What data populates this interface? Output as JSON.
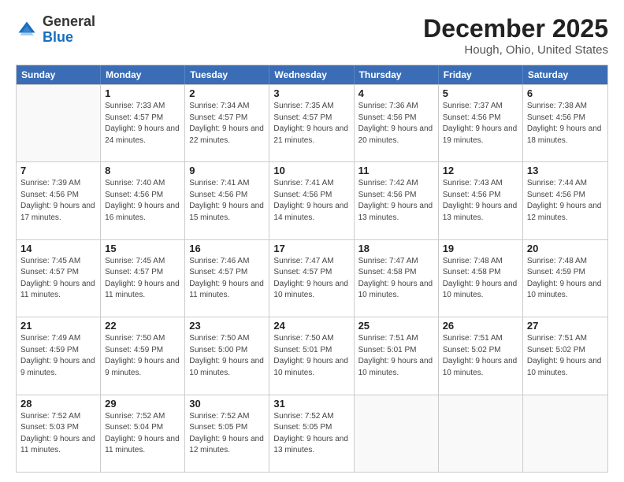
{
  "logo": {
    "text_general": "General",
    "text_blue": "Blue"
  },
  "title": "December 2025",
  "subtitle": "Hough, Ohio, United States",
  "header_days": [
    "Sunday",
    "Monday",
    "Tuesday",
    "Wednesday",
    "Thursday",
    "Friday",
    "Saturday"
  ],
  "rows": [
    [
      {
        "day": "",
        "empty": true
      },
      {
        "day": "1",
        "sunrise": "Sunrise: 7:33 AM",
        "sunset": "Sunset: 4:57 PM",
        "daylight": "Daylight: 9 hours and 24 minutes."
      },
      {
        "day": "2",
        "sunrise": "Sunrise: 7:34 AM",
        "sunset": "Sunset: 4:57 PM",
        "daylight": "Daylight: 9 hours and 22 minutes."
      },
      {
        "day": "3",
        "sunrise": "Sunrise: 7:35 AM",
        "sunset": "Sunset: 4:57 PM",
        "daylight": "Daylight: 9 hours and 21 minutes."
      },
      {
        "day": "4",
        "sunrise": "Sunrise: 7:36 AM",
        "sunset": "Sunset: 4:56 PM",
        "daylight": "Daylight: 9 hours and 20 minutes."
      },
      {
        "day": "5",
        "sunrise": "Sunrise: 7:37 AM",
        "sunset": "Sunset: 4:56 PM",
        "daylight": "Daylight: 9 hours and 19 minutes."
      },
      {
        "day": "6",
        "sunrise": "Sunrise: 7:38 AM",
        "sunset": "Sunset: 4:56 PM",
        "daylight": "Daylight: 9 hours and 18 minutes."
      }
    ],
    [
      {
        "day": "7",
        "sunrise": "Sunrise: 7:39 AM",
        "sunset": "Sunset: 4:56 PM",
        "daylight": "Daylight: 9 hours and 17 minutes."
      },
      {
        "day": "8",
        "sunrise": "Sunrise: 7:40 AM",
        "sunset": "Sunset: 4:56 PM",
        "daylight": "Daylight: 9 hours and 16 minutes."
      },
      {
        "day": "9",
        "sunrise": "Sunrise: 7:41 AM",
        "sunset": "Sunset: 4:56 PM",
        "daylight": "Daylight: 9 hours and 15 minutes."
      },
      {
        "day": "10",
        "sunrise": "Sunrise: 7:41 AM",
        "sunset": "Sunset: 4:56 PM",
        "daylight": "Daylight: 9 hours and 14 minutes."
      },
      {
        "day": "11",
        "sunrise": "Sunrise: 7:42 AM",
        "sunset": "Sunset: 4:56 PM",
        "daylight": "Daylight: 9 hours and 13 minutes."
      },
      {
        "day": "12",
        "sunrise": "Sunrise: 7:43 AM",
        "sunset": "Sunset: 4:56 PM",
        "daylight": "Daylight: 9 hours and 13 minutes."
      },
      {
        "day": "13",
        "sunrise": "Sunrise: 7:44 AM",
        "sunset": "Sunset: 4:56 PM",
        "daylight": "Daylight: 9 hours and 12 minutes."
      }
    ],
    [
      {
        "day": "14",
        "sunrise": "Sunrise: 7:45 AM",
        "sunset": "Sunset: 4:57 PM",
        "daylight": "Daylight: 9 hours and 11 minutes."
      },
      {
        "day": "15",
        "sunrise": "Sunrise: 7:45 AM",
        "sunset": "Sunset: 4:57 PM",
        "daylight": "Daylight: 9 hours and 11 minutes."
      },
      {
        "day": "16",
        "sunrise": "Sunrise: 7:46 AM",
        "sunset": "Sunset: 4:57 PM",
        "daylight": "Daylight: 9 hours and 11 minutes."
      },
      {
        "day": "17",
        "sunrise": "Sunrise: 7:47 AM",
        "sunset": "Sunset: 4:57 PM",
        "daylight": "Daylight: 9 hours and 10 minutes."
      },
      {
        "day": "18",
        "sunrise": "Sunrise: 7:47 AM",
        "sunset": "Sunset: 4:58 PM",
        "daylight": "Daylight: 9 hours and 10 minutes."
      },
      {
        "day": "19",
        "sunrise": "Sunrise: 7:48 AM",
        "sunset": "Sunset: 4:58 PM",
        "daylight": "Daylight: 9 hours and 10 minutes."
      },
      {
        "day": "20",
        "sunrise": "Sunrise: 7:48 AM",
        "sunset": "Sunset: 4:59 PM",
        "daylight": "Daylight: 9 hours and 10 minutes."
      }
    ],
    [
      {
        "day": "21",
        "sunrise": "Sunrise: 7:49 AM",
        "sunset": "Sunset: 4:59 PM",
        "daylight": "Daylight: 9 hours and 9 minutes."
      },
      {
        "day": "22",
        "sunrise": "Sunrise: 7:50 AM",
        "sunset": "Sunset: 4:59 PM",
        "daylight": "Daylight: 9 hours and 9 minutes."
      },
      {
        "day": "23",
        "sunrise": "Sunrise: 7:50 AM",
        "sunset": "Sunset: 5:00 PM",
        "daylight": "Daylight: 9 hours and 10 minutes."
      },
      {
        "day": "24",
        "sunrise": "Sunrise: 7:50 AM",
        "sunset": "Sunset: 5:01 PM",
        "daylight": "Daylight: 9 hours and 10 minutes."
      },
      {
        "day": "25",
        "sunrise": "Sunrise: 7:51 AM",
        "sunset": "Sunset: 5:01 PM",
        "daylight": "Daylight: 9 hours and 10 minutes."
      },
      {
        "day": "26",
        "sunrise": "Sunrise: 7:51 AM",
        "sunset": "Sunset: 5:02 PM",
        "daylight": "Daylight: 9 hours and 10 minutes."
      },
      {
        "day": "27",
        "sunrise": "Sunrise: 7:51 AM",
        "sunset": "Sunset: 5:02 PM",
        "daylight": "Daylight: 9 hours and 10 minutes."
      }
    ],
    [
      {
        "day": "28",
        "sunrise": "Sunrise: 7:52 AM",
        "sunset": "Sunset: 5:03 PM",
        "daylight": "Daylight: 9 hours and 11 minutes."
      },
      {
        "day": "29",
        "sunrise": "Sunrise: 7:52 AM",
        "sunset": "Sunset: 5:04 PM",
        "daylight": "Daylight: 9 hours and 11 minutes."
      },
      {
        "day": "30",
        "sunrise": "Sunrise: 7:52 AM",
        "sunset": "Sunset: 5:05 PM",
        "daylight": "Daylight: 9 hours and 12 minutes."
      },
      {
        "day": "31",
        "sunrise": "Sunrise: 7:52 AM",
        "sunset": "Sunset: 5:05 PM",
        "daylight": "Daylight: 9 hours and 13 minutes."
      },
      {
        "day": "",
        "empty": true
      },
      {
        "day": "",
        "empty": true
      },
      {
        "day": "",
        "empty": true
      }
    ]
  ]
}
